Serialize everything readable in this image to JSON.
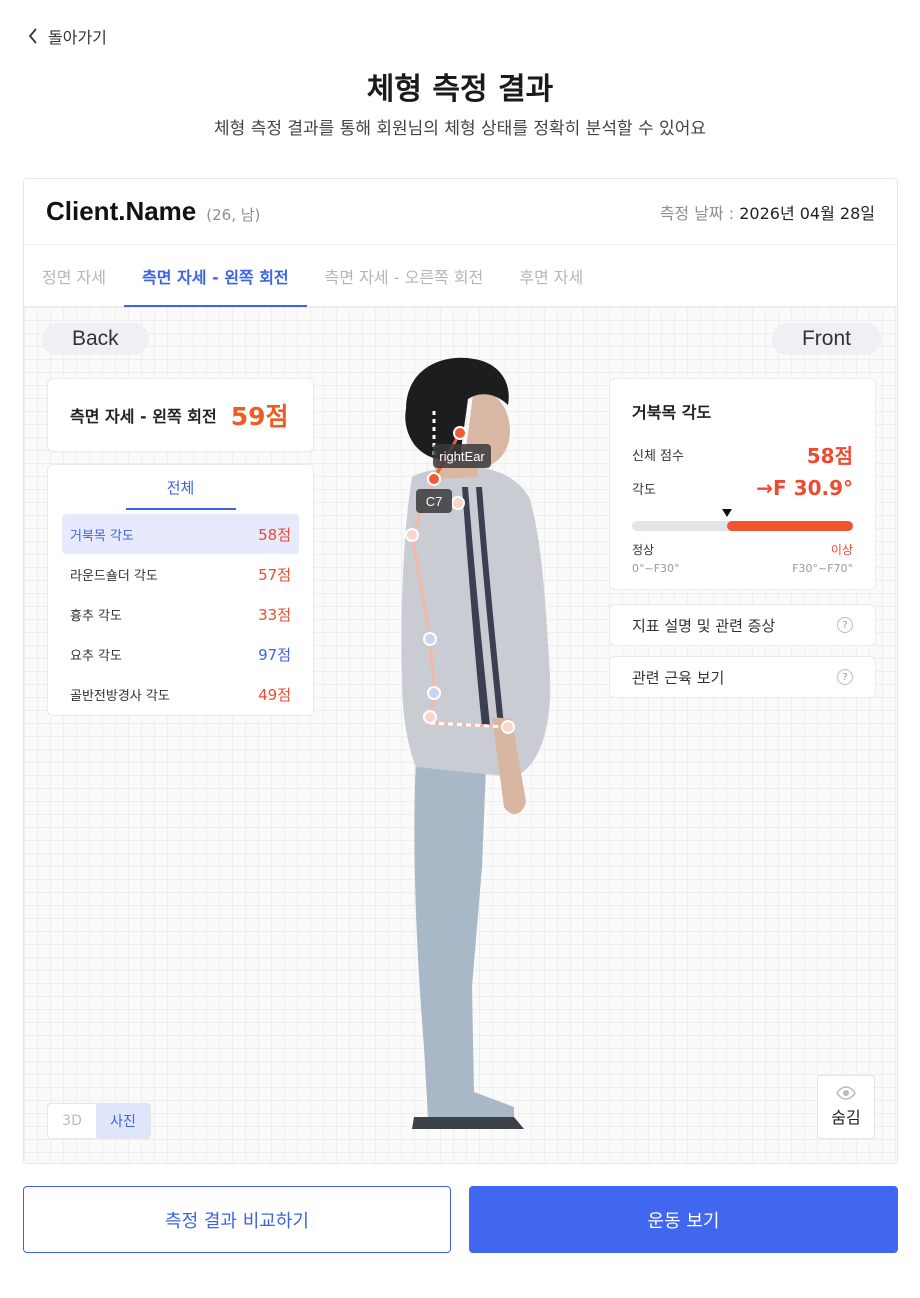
{
  "nav": {
    "back_label": "돌아가기"
  },
  "header": {
    "title": "체형 측정 결과",
    "subtitle": "체형 측정 결과를 통해 회원님의 체형 상태를 정확히 분석할 수 있어요"
  },
  "client": {
    "name": "Client.Name",
    "meta": "(26, 남)",
    "date_label": "측정 날짜 : ",
    "date_value": "2026년 04월 28일"
  },
  "tabs": [
    {
      "label": "정면 자세",
      "active": false
    },
    {
      "label": "측면 자세 - 왼쪽 회전",
      "active": true
    },
    {
      "label": "측면 자세 - 오른쪽 회전",
      "active": false
    },
    {
      "label": "후면 자세",
      "active": false
    }
  ],
  "view": {
    "back_label": "Back",
    "front_label": "Front",
    "landmark_right_ear": "rightEar",
    "landmark_c7": "C7"
  },
  "summary": {
    "label": "측면 자세 - 왼쪽 회전",
    "score": "59점"
  },
  "metrics": {
    "tab_label": "전체",
    "items": [
      {
        "label": "거북목 각도",
        "value": "58점",
        "color": "#ef4a30"
      },
      {
        "label": "라운드숄더 각도",
        "value": "57점",
        "color": "#ef4a30"
      },
      {
        "label": "흉추 각도",
        "value": "33점",
        "color": "#ef4a30"
      },
      {
        "label": "요추 각도",
        "value": "97점",
        "color": "#3d63e8"
      },
      {
        "label": "골반전방경사 각도",
        "value": "49점",
        "color": "#ef4a30"
      }
    ]
  },
  "detail": {
    "title": "거북목 각도",
    "score_label": "신체 점수",
    "score_value": "58점",
    "angle_label": "각도",
    "angle_value": "→F 30.9°",
    "gauge_fraction": 0.43,
    "normal_label": "정상",
    "normal_range": "0°~F30°",
    "over_label": "이상",
    "over_range": "F30°~F70°"
  },
  "links": {
    "description": "지표 설명 및 관련 증상",
    "muscles": "관련 근육 보기"
  },
  "view_toggle": {
    "option_3d": "3D",
    "option_photo": "사진"
  },
  "hide_label": "숨김",
  "buttons": {
    "compare": "측정 결과 비교하기",
    "exercise": "운동 보기"
  },
  "colors": {
    "accent": "#3d63e8",
    "warning": "#ef4a30",
    "primary_button": "#4166ef"
  }
}
